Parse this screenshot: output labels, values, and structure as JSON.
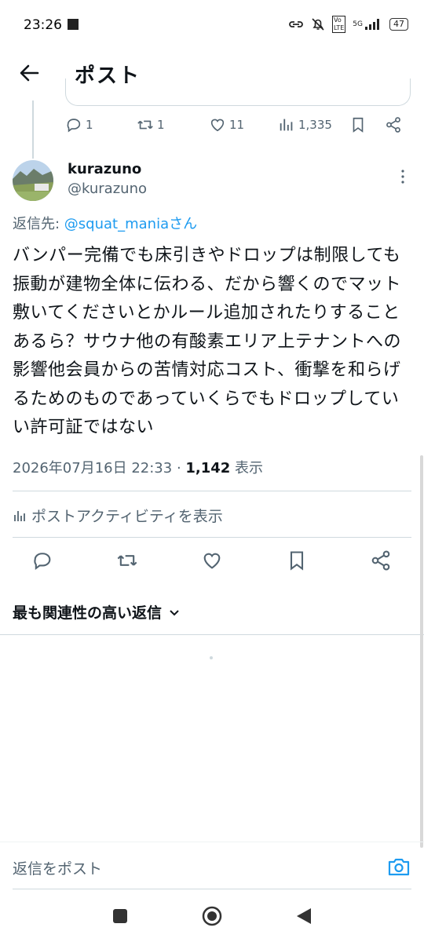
{
  "status_bar": {
    "time": "23:26",
    "battery": "47",
    "network": "5G"
  },
  "header": {
    "title": "ポスト"
  },
  "prev_post_stats": {
    "replies": "1",
    "reposts": "1",
    "likes": "11",
    "views": "1,335"
  },
  "post": {
    "author_name": "kurazuno",
    "author_handle": "@kurazuno",
    "reply_prefix": "返信先: ",
    "reply_mention": "@squat_mania",
    "reply_suffix": "さん",
    "text": "バンパー完備でも床引きやドロップは制限しても振動が建物全体に伝わる、だから響くのでマット敷いてくださいとかルール追加されたりすることあるら？サウナ他の有酸素エリア上テナントへの影響他会員からの苦情対応コスト、衝撃を和らげるためのものであっていくらでもドロップしていい許可証ではない",
    "timestamp": "2026年07月16日 22:33",
    "separator": " · ",
    "view_count": "1,142",
    "view_label": " 表示",
    "activity_label": "ポストアクティビティを表示"
  },
  "replies_sort": {
    "label": "最も関連性の高い返信"
  },
  "compose": {
    "placeholder": "返信をポスト"
  },
  "colors": {
    "accent": "#1d9bf0",
    "secondary_text": "#536471",
    "primary_text": "#0f1419",
    "divider": "#cfd9de"
  }
}
